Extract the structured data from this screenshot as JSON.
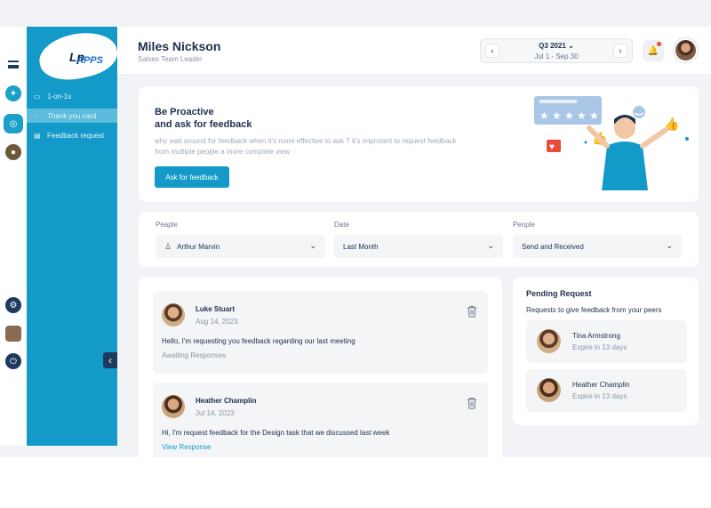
{
  "sidebar": {
    "logo_text": "APPS",
    "logo_mark": "Lp",
    "items": [
      {
        "label": "1-on-1s",
        "icon": "chat-icon"
      },
      {
        "label": "Thank you card",
        "icon": "award-icon"
      },
      {
        "label": "Feedback request",
        "icon": "feedback-icon"
      }
    ]
  },
  "header": {
    "name": "Miles Nickson",
    "role": "Salses Team Leader",
    "quarter": "Q3 2021",
    "range": "Jul 1 - Sep 30"
  },
  "hero": {
    "title_line1": "Be Proactive",
    "title_line2": "and ask for feedback",
    "description": "why wait around for feedback when it's more effective to ask ? it's improtant to request feedback from multiple people a more complete view",
    "button": "Ask for feedback"
  },
  "filters": [
    {
      "label": "Peaple",
      "value": "Arthur Marvin"
    },
    {
      "label": "Date",
      "value": "Last Month"
    },
    {
      "label": "People",
      "value": "Send and Received"
    }
  ],
  "requests": [
    {
      "name": "Luke Stuart",
      "date": "Aug 14, 2023",
      "message": "Hello, I'm requesting you feedback regarding our last meeting",
      "status": "Awaiting Responses"
    },
    {
      "name": "Heather Champlin",
      "date": "Jul 14, 2023",
      "message": "Hi, I'm request feedback for the Design task that we discussed last week",
      "status": "View Response"
    }
  ],
  "pending": {
    "title": "Pending Request",
    "subtitle": "Requests to give feedback from your peers",
    "items": [
      {
        "name": "Tina Armstrong",
        "expire": "Expire in 13 days"
      },
      {
        "name": "Heather Champlin",
        "expire": "Expire in 13 days"
      }
    ]
  },
  "colors": {
    "accent": "#139ac8",
    "navy": "#1e2f4d",
    "alert": "#e74c3c"
  }
}
